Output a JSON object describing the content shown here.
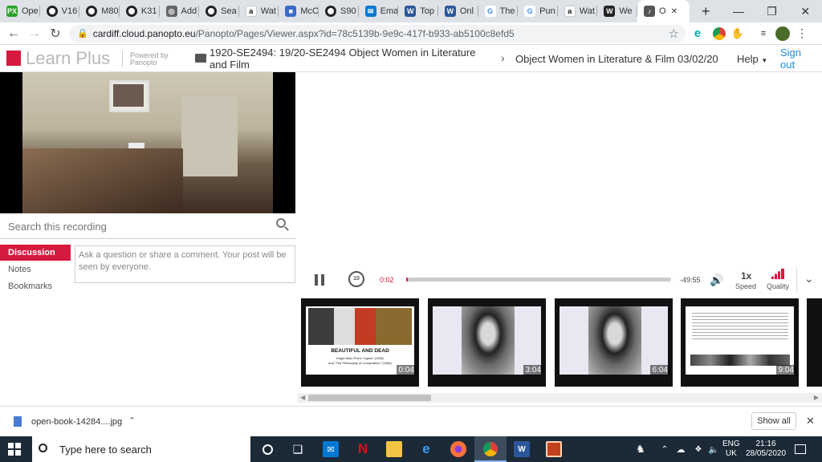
{
  "tabs": [
    {
      "label": "Ope",
      "favicon": "PX",
      "color": "#2aa12a"
    },
    {
      "label": "V16",
      "favicon": "O",
      "color": "#333"
    },
    {
      "label": "M80",
      "favicon": "O",
      "color": "#333"
    },
    {
      "label": "K31",
      "favicon": "O",
      "color": "#333"
    },
    {
      "label": "Add",
      "favicon": "globe",
      "color": "#666"
    },
    {
      "label": "Sea",
      "favicon": "O",
      "color": "#333"
    },
    {
      "label": "Wat",
      "favicon": "a",
      "color": "#111"
    },
    {
      "label": "McC",
      "favicon": "book",
      "color": "#3a6ac8"
    },
    {
      "label": "S90",
      "favicon": "O",
      "color": "#333"
    },
    {
      "label": "Ema",
      "favicon": "mail",
      "color": "#0078d4"
    },
    {
      "label": "Top",
      "favicon": "W",
      "color": "#2b579a"
    },
    {
      "label": "Onl",
      "favicon": "W",
      "color": "#2b579a"
    },
    {
      "label": "The",
      "favicon": "G",
      "color": "#4285f4"
    },
    {
      "label": "Pun",
      "favicon": "G",
      "color": "#4285f4"
    },
    {
      "label": "Wat",
      "favicon": "a",
      "color": "#111"
    },
    {
      "label": "We",
      "favicon": "W",
      "color": "#222"
    },
    {
      "label": "O",
      "favicon": "speaker",
      "color": "#555",
      "active": true
    }
  ],
  "address": {
    "host": "cardiff.cloud.panopto.eu",
    "path": "/Panopto/Pages/Viewer.aspx?id=78c5139b-9e9c-417f-b933-ab5100c8efd5"
  },
  "header": {
    "logo_text": "Learn Plus",
    "powered_by": "Powered by",
    "panopto": "Panopto",
    "folder_title": "1920-SE2494: 19/20-SE2494 Object Women in Literature and Film",
    "session_title": "Object Women in Literature & Film 03/02/20",
    "help": "Help",
    "sign_out": "Sign out"
  },
  "left": {
    "search_placeholder": "Search this recording",
    "tabs": [
      "Discussion",
      "Notes",
      "Bookmarks"
    ],
    "comment_placeholder": "Ask a question or share a comment. Your post will be seen by everyone."
  },
  "player": {
    "elapsed": "0:02",
    "remaining": "-49:55",
    "speed": "1x",
    "speed_label": "Speed",
    "quality_label": "Quality",
    "progress_fraction": 0.003
  },
  "thumbnails": [
    {
      "time": "0:04",
      "title": "BEAUTIFUL AND DEAD",
      "sub1": "Edgar Allan Poe's \"Ligeia\" (1838)",
      "sub2": "and \"The Philosophy of Composition\" (1846)"
    },
    {
      "time": "3:04"
    },
    {
      "time": "6:04"
    },
    {
      "time": "9:04"
    }
  ],
  "download": {
    "filename": "open-book-14284....jpg",
    "show_all": "Show all"
  },
  "taskbar": {
    "search": "Type here to search",
    "lang1": "ENG",
    "lang2": "UK",
    "time": "21:16",
    "date": "28/05/2020"
  },
  "colors": {
    "brand_red": "#d6193f",
    "taskbar": "#1c2a38"
  }
}
